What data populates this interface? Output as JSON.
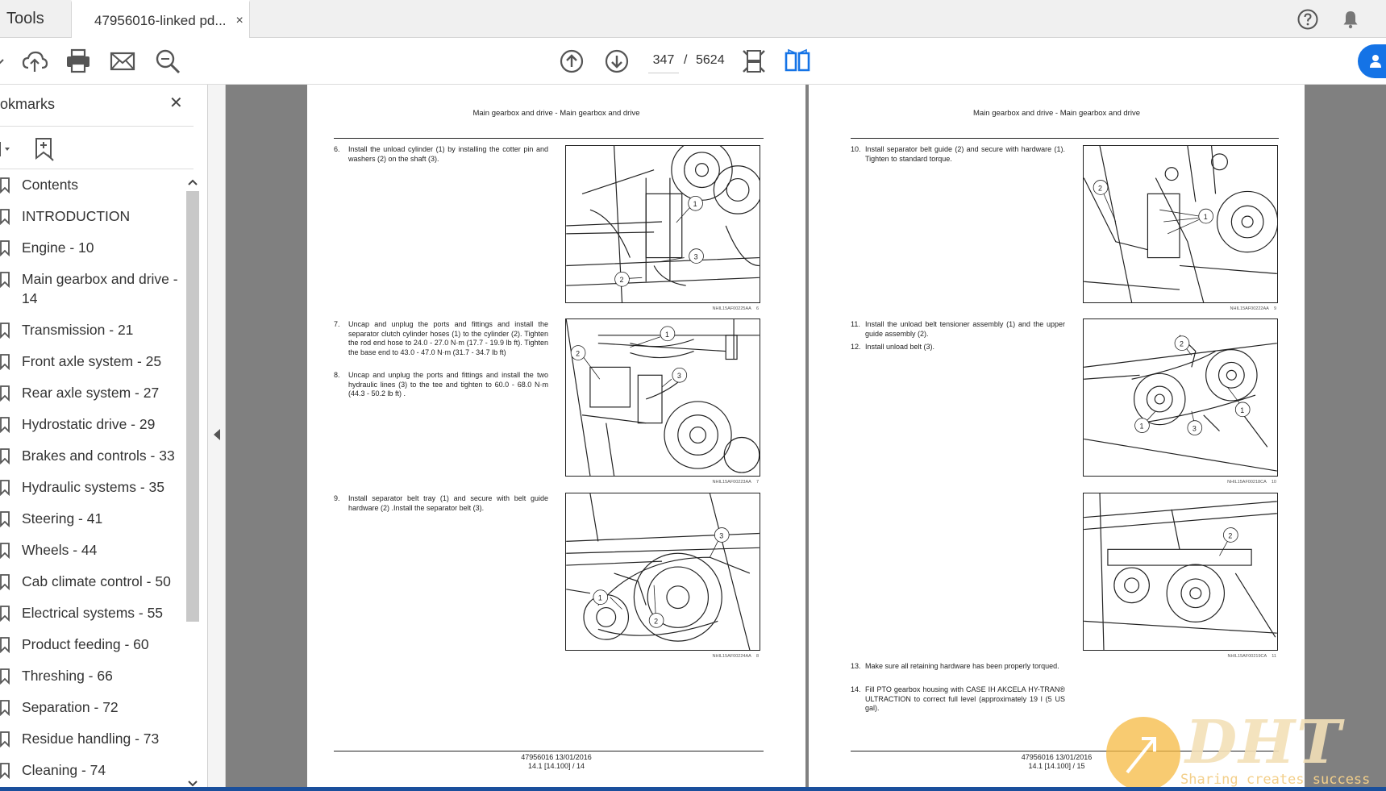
{
  "tabs": {
    "tools_label": "Tools",
    "document_tab_label": "47956016-linked pd...",
    "close_glyph": "×"
  },
  "toolbar": {
    "current_page": "347",
    "page_separator": "/",
    "total_pages": "5624"
  },
  "sidebar": {
    "title": "okmarks",
    "close_glyph": "✕",
    "bookmarks": [
      {
        "label": "Contents"
      },
      {
        "label": "INTRODUCTION"
      },
      {
        "label": "Engine - 10"
      },
      {
        "label": "Main gearbox and drive - 14"
      },
      {
        "label": "Transmission - 21"
      },
      {
        "label": "Front axle system - 25"
      },
      {
        "label": "Rear axle system - 27"
      },
      {
        "label": "Hydrostatic drive - 29"
      },
      {
        "label": "Brakes and controls - 33"
      },
      {
        "label": "Hydraulic systems - 35"
      },
      {
        "label": "Steering - 41"
      },
      {
        "label": "Wheels - 44"
      },
      {
        "label": "Cab climate control - 50"
      },
      {
        "label": "Electrical systems - 55"
      },
      {
        "label": "Product feeding - 60"
      },
      {
        "label": "Threshing - 66"
      },
      {
        "label": "Separation - 72"
      },
      {
        "label": "Residue handling - 73"
      },
      {
        "label": "Cleaning - 74"
      }
    ]
  },
  "left_page": {
    "header": "Main gearbox and drive - Main gearbox and drive",
    "steps": [
      {
        "num": "6.",
        "text": "Install the unload cylinder (1) by installing the cotter pin and washers (2) on the shaft (3)."
      },
      {
        "num": "7.",
        "text": "Uncap and unplug the ports and fittings and install the separator clutch cylinder hoses (1) to the cylinder (2). Tighten the rod end hose to 24.0 - 27.0 N·m (17.7 - 19.9 lb ft). Tighten the base end to 43.0 - 47.0 N·m (31.7 - 34.7 lb ft)"
      },
      {
        "num": "8.",
        "text": "Uncap and unplug the ports and fittings and install the two hydraulic lines (3) to the tee and tighten to 60.0 - 68.0 N·m (44.3 - 50.2 lb ft) ."
      },
      {
        "num": "9.",
        "text": "Install separator belt tray (1) and secure with belt guide hardware (2) .Install the separator belt (3)."
      }
    ],
    "figures": [
      {
        "caption": "NHIL15AF00225AA",
        "index": "6"
      },
      {
        "caption": "NHIL15AF00223AA",
        "index": "7"
      },
      {
        "caption": "NHIL15AF00224AA",
        "index": "8"
      }
    ],
    "footer_line1": "47956016 13/01/2016",
    "footer_line2": "14.1 [14.100] / 14"
  },
  "right_page": {
    "header": "Main gearbox and drive - Main gearbox and drive",
    "steps": [
      {
        "num": "10.",
        "text": "Install separator belt guide (2) and secure with hardware (1). Tighten to standard torque."
      },
      {
        "num": "11.",
        "text": "Install the unload belt tensioner assembly (1) and the upper guide assembly (2)."
      },
      {
        "num": "12.",
        "text": "Install unload belt (3)."
      },
      {
        "num": "13.",
        "text": "Make sure all retaining hardware has been properly torqued."
      },
      {
        "num": "14.",
        "text": "Fill PTO gearbox housing with CASE IH AKCELA HY-TRAN® ULTRACTION to correct full level (approximately 19 l (5 US gal)."
      }
    ],
    "figures": [
      {
        "caption": "NHIL15AF00222AA",
        "index": "9"
      },
      {
        "caption": "NHIL15AF00218CA",
        "index": "10"
      },
      {
        "caption": "NHIL15AF00219CA",
        "index": "11"
      }
    ],
    "footer_line1": "47956016 13/01/2016",
    "footer_line2": "14.1 [14.100] / 15"
  },
  "watermark": {
    "logo_text": "DHT",
    "tagline": "Sharing creates success"
  },
  "colors": {
    "accent_blue": "#1473e6",
    "viewer_gray": "#808080",
    "watermark_orange": "#f5b942"
  }
}
